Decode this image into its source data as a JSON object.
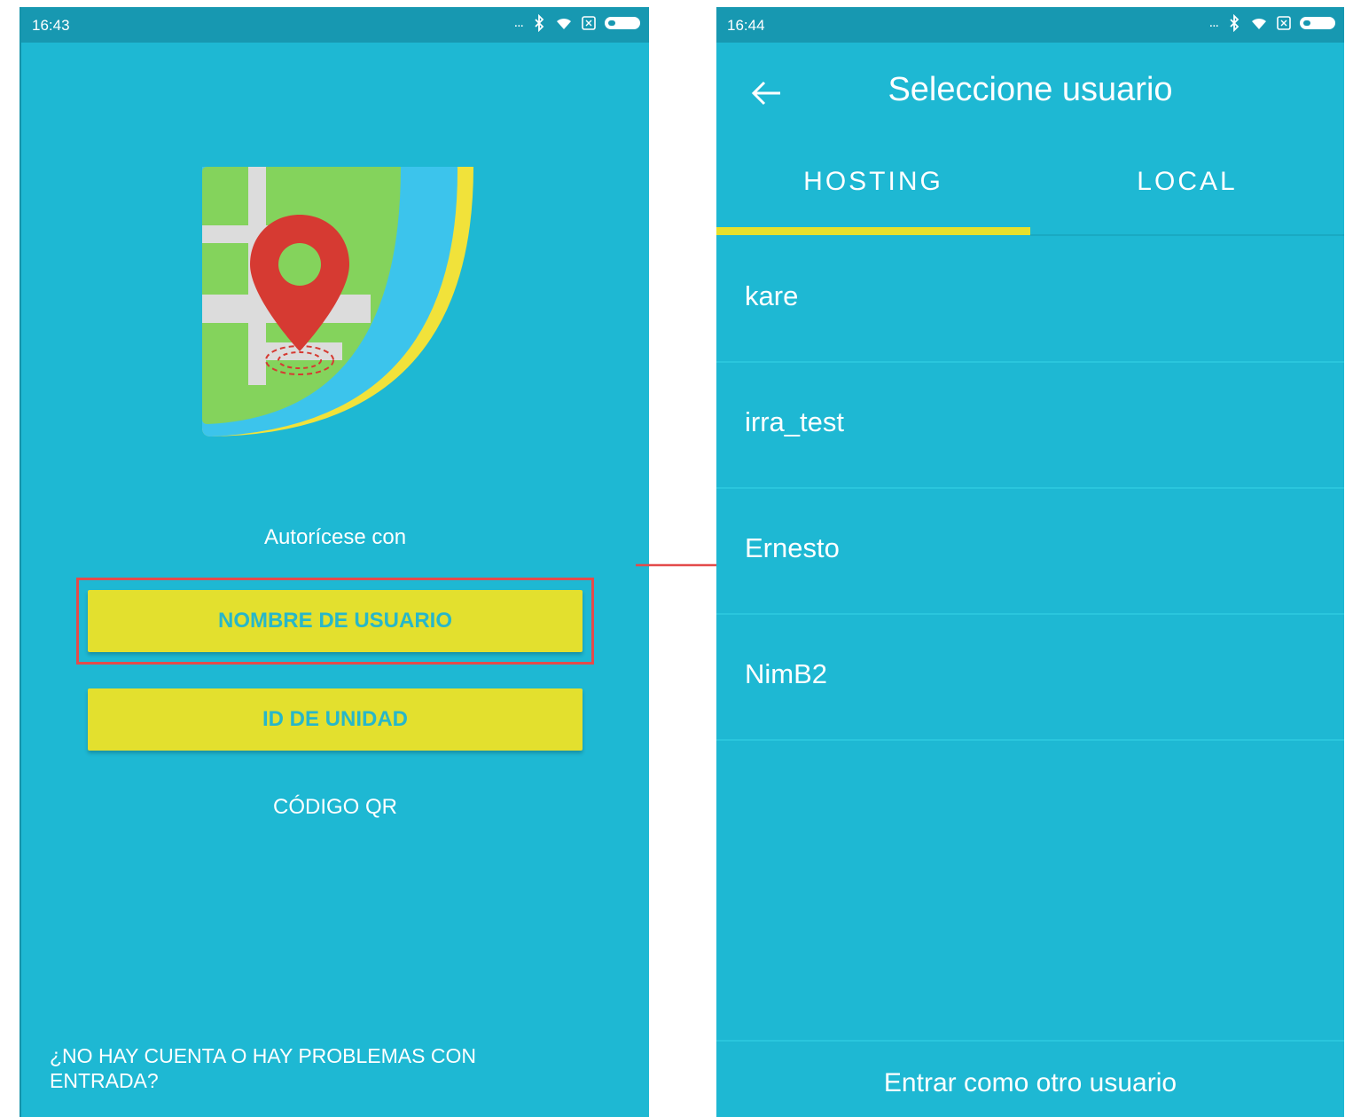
{
  "colors": {
    "screen_bg": "#1eb8d3",
    "status_bar": "#1798b1",
    "button_yellow": "#e3e02e",
    "button_text": "#27b7c9",
    "highlight_red": "#e34b4b",
    "tab_indicator": "#e6e02c"
  },
  "left_screen": {
    "status_time": "16:43",
    "status_dots": "...",
    "auth_prompt": "Autorícese con",
    "button_username": "NOMBRE DE USUARIO",
    "button_unit_id": "ID DE UNIDAD",
    "qr_link": "CÓDIGO QR",
    "problems_link": "¿NO HAY CUENTA O HAY PROBLEMAS CON ENTRADA?"
  },
  "right_screen": {
    "status_time": "16:44",
    "status_dots": "...",
    "title": "Seleccione usuario",
    "tabs": [
      {
        "label": "HOSTING",
        "selected": true
      },
      {
        "label": "LOCAL",
        "selected": false
      }
    ],
    "users": [
      {
        "name": "kare"
      },
      {
        "name": "irra_test"
      },
      {
        "name": "Ernesto"
      },
      {
        "name": "NimB2"
      }
    ],
    "other_user": "Entrar como otro usuario"
  },
  "icons": {
    "back": "arrow-left-icon",
    "bluetooth": "bluetooth-icon",
    "wifi": "wifi-icon",
    "sim": "sim-icon",
    "battery": "battery-icon",
    "logo": "map-pin-logo"
  }
}
